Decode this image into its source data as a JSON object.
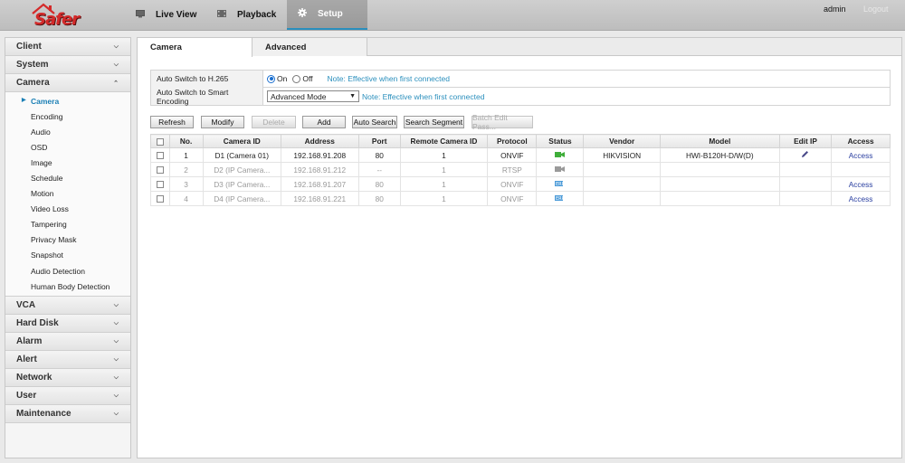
{
  "header": {
    "logo_text": "Safer",
    "nav": [
      {
        "label": "Live View",
        "icon": "monitor-icon"
      },
      {
        "label": "Playback",
        "icon": "film-icon"
      },
      {
        "label": "Setup",
        "icon": "gear-icon"
      }
    ],
    "user": "admin",
    "logout": "Logout",
    "accent_color": "#2a8fbd"
  },
  "sidebar": {
    "sections": [
      {
        "label": "Client",
        "expanded": false
      },
      {
        "label": "System",
        "expanded": false
      },
      {
        "label": "Camera",
        "expanded": true
      },
      {
        "label": "VCA",
        "expanded": false
      },
      {
        "label": "Hard Disk",
        "expanded": false
      },
      {
        "label": "Alarm",
        "expanded": false
      },
      {
        "label": "Alert",
        "expanded": false
      },
      {
        "label": "Network",
        "expanded": false
      },
      {
        "label": "User",
        "expanded": false
      },
      {
        "label": "Maintenance",
        "expanded": false
      }
    ],
    "camera_items": [
      "Camera",
      "Encoding",
      "Audio",
      "OSD",
      "Image",
      "Schedule",
      "Motion",
      "Video Loss",
      "Tampering",
      "Privacy Mask",
      "Snapshot",
      "Audio Detection",
      "Human Body Detection"
    ],
    "active_item": "Camera"
  },
  "tabs": [
    "Camera",
    "Advanced"
  ],
  "form": {
    "h265_label": "Auto Switch to H.265",
    "on_label": "On",
    "off_label": "Off",
    "h265_note": "Note: Effective when first connected",
    "smart_label": "Auto Switch to Smart Encoding",
    "smart_value": "Advanced Mode",
    "smart_note": "Note: Effective when first connected"
  },
  "toolbar": {
    "refresh": "Refresh",
    "modify": "Modify",
    "delete": "Delete",
    "add": "Add",
    "auto_search": "Auto Search",
    "search_segment": "Search Segment",
    "batch_edit": "Batch Edit Pass..."
  },
  "table": {
    "headers": [
      "No.",
      "Camera ID",
      "Address",
      "Port",
      "Remote Camera ID",
      "Protocol",
      "Status",
      "Vendor",
      "Model",
      "Edit IP",
      "Access"
    ],
    "rows": [
      {
        "no": "1",
        "camera_id": "D1 (Camera 01)",
        "address": "192.168.91.208",
        "port": "80",
        "remote_id": "1",
        "protocol": "ONVIF",
        "status": "online",
        "vendor": "HIKVISION",
        "model": "HWI-B120H-D/W(D)",
        "edit_ip": true,
        "access": "Access",
        "dim": false
      },
      {
        "no": "2",
        "camera_id": "D2 (IP Camera...",
        "address": "192.168.91.212",
        "port": "--",
        "remote_id": "1",
        "protocol": "RTSP",
        "status": "offline",
        "vendor": "",
        "model": "",
        "edit_ip": false,
        "access": "",
        "dim": true
      },
      {
        "no": "3",
        "camera_id": "D3 (IP Camera...",
        "address": "192.168.91.207",
        "port": "80",
        "remote_id": "1",
        "protocol": "ONVIF",
        "status": "error",
        "vendor": "",
        "model": "",
        "edit_ip": false,
        "access": "Access",
        "dim": true
      },
      {
        "no": "4",
        "camera_id": "D4 (IP Camera...",
        "address": "192.168.91.221",
        "port": "80",
        "remote_id": "1",
        "protocol": "ONVIF",
        "status": "error",
        "vendor": "",
        "model": "",
        "edit_ip": false,
        "access": "Access",
        "dim": true
      }
    ]
  }
}
